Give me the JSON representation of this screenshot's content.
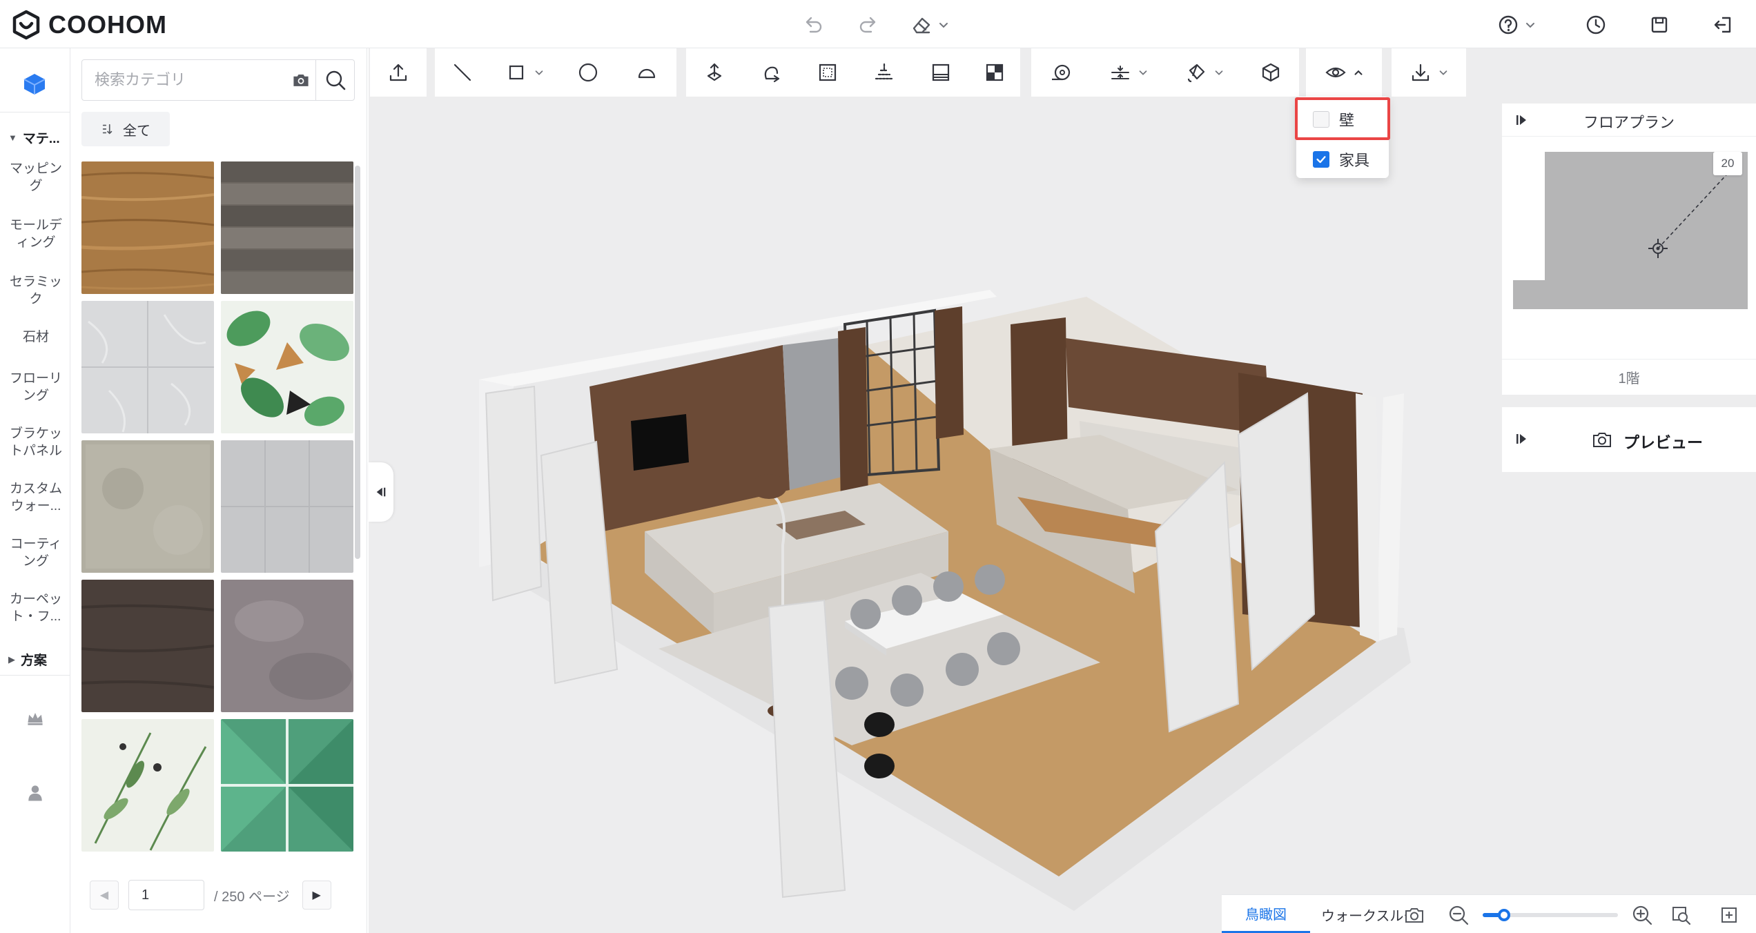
{
  "app": {
    "logo_text": "COOHOM"
  },
  "header": {
    "icons": [
      "undo-icon",
      "redo-icon",
      "eraser-icon",
      "help-icon",
      "history-icon",
      "save-icon",
      "exit-icon"
    ]
  },
  "left_nav": {
    "group_materials": "マテ...",
    "items": [
      {
        "label": "マッピング"
      },
      {
        "label": "モールディング"
      },
      {
        "label": "セラミック"
      },
      {
        "label": "石材"
      },
      {
        "label": "フローリング"
      },
      {
        "label": "ブラケットパネル"
      },
      {
        "label": "カスタムウォー..."
      },
      {
        "label": "コーティング"
      },
      {
        "label": "カーペット・フ..."
      }
    ],
    "group_plans": "方案"
  },
  "material_panel": {
    "search_placeholder": "検索カテゴリ",
    "filter_label": "全て",
    "swatches": [
      {
        "name": "wood-oak",
        "color": "#a97a45"
      },
      {
        "name": "wood-grey-plank",
        "color": "#6d6761"
      },
      {
        "name": "marble-white-tile",
        "color": "#d9dadc"
      },
      {
        "name": "tropical-leaf",
        "color": "#e8efe6"
      },
      {
        "name": "stone-beige",
        "color": "#b1aea1"
      },
      {
        "name": "tile-grey",
        "color": "#c6c7c9"
      },
      {
        "name": "wood-dark",
        "color": "#4a3f3a"
      },
      {
        "name": "velvet-mauve",
        "color": "#8c8387"
      },
      {
        "name": "leaf-pattern",
        "color": "#e3e8de"
      },
      {
        "name": "green-geometric",
        "color": "#4f9f7b"
      }
    ],
    "pager": {
      "current": "1",
      "total_label": "/ 250 ページ"
    }
  },
  "toolbar": {
    "groups": [
      [
        "upload-icon"
      ],
      [
        "line-icon",
        "rectangle-icon",
        "circle-icon",
        "arc-icon"
      ],
      [
        "move-3d-icon",
        "rotate-icon",
        "frame-icon",
        "align-icon",
        "panel-icon",
        "split-icon"
      ],
      [
        "measure-icon",
        "offset-icon",
        "paint-icon",
        "box-icon"
      ],
      [
        "eye-icon"
      ],
      [
        "download-icon"
      ]
    ]
  },
  "visibility_menu": {
    "items": [
      {
        "label": "壁",
        "checked": false
      },
      {
        "label": "家具",
        "checked": true
      }
    ]
  },
  "floorplan": {
    "title": "フロアプラン",
    "scale": "20",
    "floor": "1階"
  },
  "preview": {
    "title": "プレビュー"
  },
  "bottom": {
    "tab_birdseye": "鳥瞰図",
    "tab_walkthrough": "ウォークスルー",
    "zoom": 0.16
  },
  "colors": {
    "accent": "#1a74e8",
    "highlight": "#ea4545",
    "canvas": "#ededee"
  }
}
